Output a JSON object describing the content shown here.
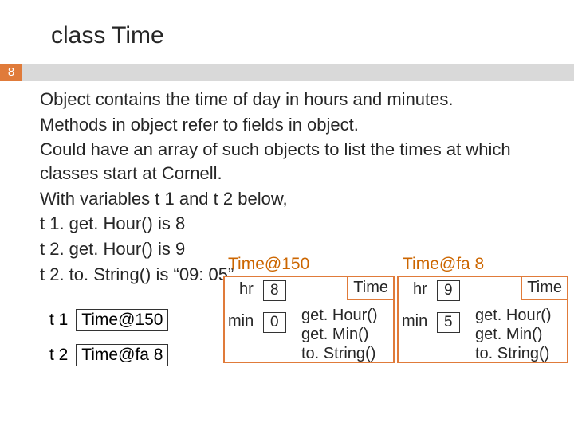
{
  "slide": {
    "title": "class Time",
    "page_number": "8"
  },
  "body": {
    "p1": "Object contains the time of day in hours and minutes.",
    "p2": "Methods in object refer to fields in object.",
    "p3": "Could have an array of such objects to list the times at which classes start at Cornell.",
    "p4": "With variables t 1 and t 2 below,",
    "p5": "t 1. get. Hour()  is  8",
    "p6": "t 2. get. Hour()  is  9",
    "p7": "t 2. to. String()  is  “09: 05”"
  },
  "vars": {
    "t1": {
      "label": "t 1",
      "value": "Time@150"
    },
    "t2": {
      "label": "t 2",
      "value": "Time@fa 8"
    }
  },
  "objects": {
    "a": {
      "id_label": "Time@150",
      "type_tab": "Time",
      "hr_label": "hr",
      "hr_value": "8",
      "min_label": "min",
      "min_value": "0",
      "methods": {
        "m1": "get. Hour()",
        "m2": "get. Min()",
        "m3": "to. String()"
      }
    },
    "b": {
      "id_label": "Time@fa 8",
      "type_tab": "Time",
      "hr_label": "hr",
      "hr_value": "9",
      "min_label": "min",
      "min_value": "5",
      "methods": {
        "m1": "get. Hour()",
        "m2": "get. Min()",
        "m3": "to. String()"
      }
    }
  }
}
